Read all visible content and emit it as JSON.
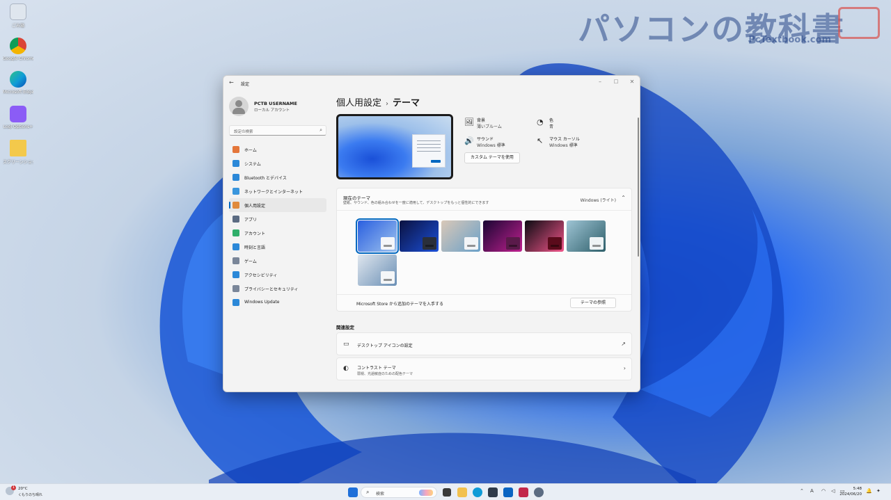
{
  "watermark": {
    "title": "パソコンの教科書",
    "site": "PcTextbook.com"
  },
  "desktop": {
    "icons": [
      {
        "label": "ごみ箱",
        "icon": "recycle-bin-icon",
        "color": "#dfe6ee"
      },
      {
        "label": "Google Chrome",
        "icon": "chrome-icon",
        "color": "#db4437"
      },
      {
        "label": "Microsoft Edge",
        "icon": "edge-icon",
        "color": "#0f9bd7"
      },
      {
        "label": "Logi Options+",
        "icon": "logi-options-icon",
        "color": "#8b5cf6"
      },
      {
        "label": "スクリーンショット",
        "icon": "folder-icon",
        "color": "#f3c94b"
      }
    ]
  },
  "window": {
    "title": "設定",
    "profile": {
      "name": "PCTB USERNAME",
      "account": "ローカル アカウント"
    },
    "search_placeholder": "設定の検索",
    "nav": [
      {
        "label": "ホーム",
        "icon": "home-icon",
        "color": "#e4763a"
      },
      {
        "label": "システム",
        "icon": "system-icon",
        "color": "#2b88d8"
      },
      {
        "label": "Bluetooth とデバイス",
        "icon": "bluetooth-icon",
        "color": "#2b88d8"
      },
      {
        "label": "ネットワークとインターネット",
        "icon": "network-icon",
        "color": "#3a96dd"
      },
      {
        "label": "個人用設定",
        "icon": "personalization-icon",
        "color": "#e08a3c",
        "active": true
      },
      {
        "label": "アプリ",
        "icon": "apps-icon",
        "color": "#5b6b82"
      },
      {
        "label": "アカウント",
        "icon": "accounts-icon",
        "color": "#2fae6a"
      },
      {
        "label": "時刻と言語",
        "icon": "time-language-icon",
        "color": "#2b88d8"
      },
      {
        "label": "ゲーム",
        "icon": "gaming-icon",
        "color": "#7a8699"
      },
      {
        "label": "アクセシビリティ",
        "icon": "accessibility-icon",
        "color": "#2b88d8"
      },
      {
        "label": "プライバシーとセキュリティ",
        "icon": "shield-icon",
        "color": "#7a8699"
      },
      {
        "label": "Windows Update",
        "icon": "windows-update-icon",
        "color": "#2b88d8"
      }
    ],
    "breadcrumb": {
      "parent": "個人用設定",
      "separator": "›",
      "current": "テーマ"
    },
    "quick": {
      "background": {
        "title": "背景",
        "value": "薄いブルーム",
        "icon": "picture-icon"
      },
      "color": {
        "title": "色",
        "value": "青",
        "icon": "palette-icon"
      },
      "sound": {
        "title": "サウンド",
        "value": "Windows 標準",
        "icon": "speaker-icon"
      },
      "cursor": {
        "title": "マウス カーソル",
        "value": "Windows 標準",
        "icon": "cursor-icon"
      }
    },
    "custom_button": "カスタム テーマを使用",
    "current_theme": {
      "title": "現在のテーマ",
      "desc": "壁紙、サウンド、色の組み合わせを一度に適用して、デスクトップをもっと個性的にできます",
      "value": "Windows (ライト)"
    },
    "themes": [
      {
        "name": "windows-light",
        "colors": [
          "#2a5fe0",
          "#9dc2ee"
        ],
        "window": "#f4f6f9",
        "selected": true
      },
      {
        "name": "windows-dark",
        "colors": [
          "#0b1240",
          "#1b4fd8"
        ],
        "window": "#2a2f3a",
        "selected": false
      },
      {
        "name": "glow",
        "colors": [
          "#d9c8b8",
          "#6aa0c8"
        ],
        "window": "#f2f4f7",
        "selected": false
      },
      {
        "name": "captured-motion",
        "colors": [
          "#1a0633",
          "#c0208f"
        ],
        "window": "#5a1a4a",
        "selected": false
      },
      {
        "name": "flow",
        "colors": [
          "#0b0b12",
          "#f2558a"
        ],
        "window": "#5a0b1b",
        "selected": false
      },
      {
        "name": "sunrise",
        "colors": [
          "#9ec4d4",
          "#2e5f6a"
        ],
        "window": "#eef3f5",
        "selected": false
      },
      {
        "name": "bloom-gray",
        "colors": [
          "#dfe6ee",
          "#6a8fb5"
        ],
        "window": "#f4f6f8",
        "selected": false
      }
    ],
    "store_text": "Microsoft Store から追加のテーマを入手する",
    "browse_button": "テーマの参照",
    "related_title": "関連設定",
    "related": [
      {
        "title": "デスクトップ アイコンの設定",
        "icon": "monitor-icon",
        "end_icon": "external-link-icon"
      },
      {
        "title": "コントラスト テーマ",
        "desc": "弱視、光過敏症のための配色テーマ",
        "icon": "contrast-icon",
        "end_icon": "chevron-right-icon"
      }
    ]
  },
  "taskbar": {
    "weather": {
      "temp": "20°C",
      "desc": "くもりのち晴れ",
      "badge": "1"
    },
    "search_placeholder": "検索",
    "apps": [
      {
        "name": "start-button-icon",
        "color": "#1e6fd9"
      },
      {
        "name": "task-view-icon",
        "color": "#3a3a3a"
      },
      {
        "name": "file-explorer-icon",
        "color": "#f2c14e"
      },
      {
        "name": "edge-icon",
        "color": "#0f9bd7"
      },
      {
        "name": "store-icon",
        "color": "#2f3a4a"
      },
      {
        "name": "outlook-icon",
        "color": "#0a64c2"
      },
      {
        "name": "snipping-tool-icon",
        "color": "#c2274b"
      },
      {
        "name": "settings-icon",
        "color": "#5b6b82"
      }
    ],
    "clock": {
      "time": "5:48",
      "date": "2024/06/20"
    }
  }
}
